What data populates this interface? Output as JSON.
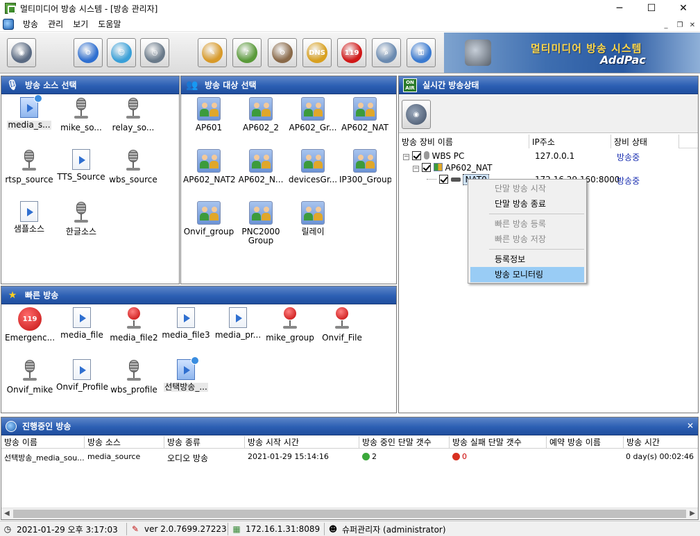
{
  "window": {
    "title": "멀티미디어 방송 시스템 - [방송 관리자]",
    "minimize": "─",
    "maximize": "☐",
    "close": "✕"
  },
  "menu": [
    "방송",
    "관리",
    "보기",
    "도움말"
  ],
  "mdi": {
    "minimize": "_",
    "restore": "❐",
    "close": "✕"
  },
  "banner": {
    "title": "멀티미디어 방송 시스템",
    "brand": "AddPac"
  },
  "toolbar": [
    {
      "name": "broadcast-monitor",
      "glyph": "◉",
      "color": "#5a6a82"
    },
    {
      "name": "network-settings",
      "glyph": "⚙",
      "color": "#2f6fd0"
    },
    {
      "name": "user-management",
      "glyph": "☺",
      "color": "#3aa0d8"
    },
    {
      "name": "schedule",
      "glyph": "◷",
      "color": "#6a7a8a"
    },
    {
      "name": "broadcast-file",
      "glyph": "✎",
      "color": "#d89a2a"
    },
    {
      "name": "voice-broadcast",
      "glyph": "♪",
      "color": "#5a9a3a"
    },
    {
      "name": "device-settings",
      "glyph": "⚙",
      "color": "#8a6a4a"
    },
    {
      "name": "dns",
      "glyph": "DNS",
      "color": "#d8a020"
    },
    {
      "name": "emergency-119",
      "glyph": "119",
      "color": "#d01818"
    },
    {
      "name": "search-log",
      "glyph": "⌕",
      "color": "#6a8ab0"
    },
    {
      "name": "security-lock",
      "glyph": "⚿",
      "color": "#3a7ad0"
    }
  ],
  "source_panel": {
    "title": "방송 소스 선택",
    "items": [
      {
        "label": "media_s...",
        "icon": "file-active",
        "selected": true
      },
      {
        "label": "mike_so...",
        "icon": "mic"
      },
      {
        "label": "relay_so...",
        "icon": "mic"
      },
      {
        "label": "rtsp_source",
        "icon": "mic"
      },
      {
        "label": "TTS_Source",
        "icon": "file"
      },
      {
        "label": "wbs_source",
        "icon": "mic"
      },
      {
        "label": "샘플소스",
        "icon": "file"
      },
      {
        "label": "한글소스",
        "icon": "mic"
      }
    ]
  },
  "target_panel": {
    "title": "방송 대상 선택",
    "items": [
      {
        "label": "AP601"
      },
      {
        "label": "AP602_2"
      },
      {
        "label": "AP602_Gr..."
      },
      {
        "label": "AP602_NAT"
      },
      {
        "label": "AP602_NAT2"
      },
      {
        "label": "AP602_N..."
      },
      {
        "label": "devicesGr..."
      },
      {
        "label": "IP300_Group"
      },
      {
        "label": "Onvif_group"
      },
      {
        "label": "PNC2000\nGroup"
      },
      {
        "label": "릴레이"
      }
    ]
  },
  "quick_panel": {
    "title": "빠른 방송",
    "items": [
      {
        "label": "Emergenc...",
        "icon": "119"
      },
      {
        "label": "media_file",
        "icon": "file"
      },
      {
        "label": "media_file2",
        "icon": "mic-red"
      },
      {
        "label": "media_file3",
        "icon": "file"
      },
      {
        "label": "media_pr...",
        "icon": "file"
      },
      {
        "label": "mike_group",
        "icon": "mic-red"
      },
      {
        "label": "Onvif_File",
        "icon": "mic-red"
      },
      {
        "label": "Onvif_mike",
        "icon": "mic"
      },
      {
        "label": "Onvif_Profile",
        "icon": "file"
      },
      {
        "label": "wbs_profile",
        "icon": "mic"
      },
      {
        "label": "선택방송_...",
        "icon": "file-active",
        "selected": true
      }
    ]
  },
  "status_panel": {
    "title": "실시간 방송상태",
    "badge_top": "ON",
    "badge_bottom": "AIR",
    "columns": [
      "방송 장비 이름",
      "IP주소",
      "장비 상태"
    ],
    "tree": [
      {
        "name": "WBS PC",
        "ip": "127.0.0.1",
        "state": "방송중"
      },
      {
        "name": "AP602_NAT",
        "ip": "",
        "state": ""
      },
      {
        "name": "NAT0",
        "ip": "172.16.29.160:8000",
        "state": "방송중"
      }
    ]
  },
  "context_menu": {
    "items": [
      {
        "label": "단말 방송 시작",
        "disabled": true
      },
      {
        "label": "단말 방송 종료",
        "disabled": false
      },
      {
        "label": "빠른 방송 등록",
        "disabled": true
      },
      {
        "label": "빠른 방송 저장",
        "disabled": true
      },
      {
        "label": "등록정보",
        "disabled": false
      },
      {
        "label": "방송 모니터링",
        "disabled": false,
        "highlight": true
      }
    ]
  },
  "live_panel": {
    "title": "진행중인 방송",
    "close": "✕",
    "columns": [
      "방송 이름",
      "방송 소스",
      "방송 종류",
      "방송 시작 시간",
      "방송 중인 단말 갯수",
      "방송 실패 단말 갯수",
      "예약 방송 이름",
      "방송 시간"
    ],
    "row": {
      "name": "선택방송_media_sou...",
      "source": "media_source",
      "type": "오디오 방송",
      "start": "2021-01-29 15:14:16",
      "active": "2",
      "failed": "0",
      "reserved": "",
      "duration": "0 day(s) 00:02:46"
    }
  },
  "statusbar": {
    "datetime": "2021-01-29 오후 3:17:03",
    "version": "ver 2.0.7699.27223",
    "server": "172.16.1.31:8089",
    "user": "슈퍼관리자 (administrator)"
  }
}
